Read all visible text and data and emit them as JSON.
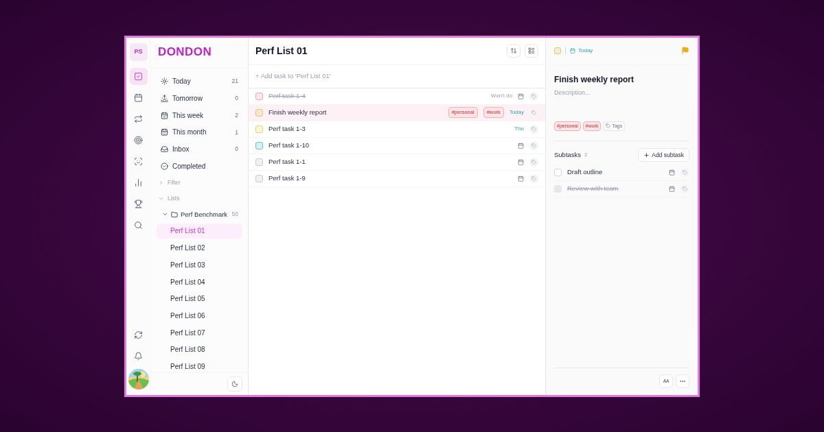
{
  "rail": {
    "avatar": "PS",
    "items": [
      {
        "kind": "tasks",
        "selected": true
      },
      {
        "kind": "calendar",
        "selected": false
      },
      {
        "kind": "repeat",
        "selected": false
      },
      {
        "kind": "target",
        "selected": false
      },
      {
        "kind": "focus",
        "selected": false
      },
      {
        "kind": "stats",
        "selected": false
      },
      {
        "kind": "trophy",
        "selected": false
      },
      {
        "kind": "search",
        "selected": false
      }
    ],
    "bottom": [
      {
        "kind": "sync"
      },
      {
        "kind": "bell"
      }
    ]
  },
  "sidebar": {
    "logo": "DONDON",
    "nav": [
      {
        "kind": "today",
        "label": "Today",
        "count": "21"
      },
      {
        "kind": "tomorrow",
        "label": "Tomorrow",
        "count": "0"
      },
      {
        "kind": "week",
        "label": "This week",
        "count": "2"
      },
      {
        "kind": "month",
        "label": "This month",
        "count": "1"
      },
      {
        "kind": "inbox",
        "label": "Inbox",
        "count": "0"
      },
      {
        "kind": "completed",
        "label": "Completed"
      }
    ],
    "filter": {
      "label": "Filter",
      "expanded": false
    },
    "lists": {
      "label": "Lists",
      "expanded": true,
      "folder": {
        "label": "Perf Benchmark",
        "count": "50",
        "expanded": true,
        "children": [
          {
            "label": "Perf List 01",
            "selected": true
          },
          {
            "label": "Perf List 02",
            "selected": false
          },
          {
            "label": "Perf List 03",
            "selected": false
          },
          {
            "label": "Perf List 04",
            "selected": false
          },
          {
            "label": "Perf List 05",
            "selected": false
          },
          {
            "label": "Perf List 06",
            "selected": false
          },
          {
            "label": "Perf List 07",
            "selected": false
          },
          {
            "label": "Perf List 08",
            "selected": false
          },
          {
            "label": "Perf List 09",
            "selected": false
          }
        ]
      }
    }
  },
  "main": {
    "title": "Perf List 01",
    "add_placeholder": "+ Add task to 'Perf List 01'",
    "tasks": [
      {
        "title": "Perf task 1-4",
        "color": "#f4a3b4",
        "done": true,
        "selected": false,
        "status": "Won't do"
      },
      {
        "title": "Finish weekly report",
        "color": "#e9c46a",
        "done": false,
        "selected": true,
        "due": "Today",
        "tags": [
          "#personal",
          "#work"
        ]
      },
      {
        "title": "Perf task 1-3",
        "color": "#e9d66a",
        "done": false,
        "selected": false,
        "due": "Thu"
      },
      {
        "title": "Perf task 1-10",
        "color": "#5cc8c8",
        "done": false,
        "selected": false
      },
      {
        "title": "Perf task 1-1",
        "color": "#c8c8c8",
        "done": false,
        "selected": false
      },
      {
        "title": "Perf task 1-9",
        "color": "#c8c8c8",
        "done": false,
        "selected": false
      }
    ]
  },
  "detail": {
    "priority": {
      "color": "#e9c46a"
    },
    "date": "Today",
    "flagged": true,
    "title": "Finish weekly report",
    "description_placeholder": "Description...",
    "tags": [
      "#personal",
      "#work"
    ],
    "tags_button": "Tags",
    "subtasks_label": "Subtasks",
    "subtasks_count": "2",
    "add_subtask": "Add subtask",
    "subtasks": [
      {
        "title": "Draft outline",
        "checked": false
      },
      {
        "title": "Review with team",
        "checked": true
      }
    ],
    "font_button": "AA"
  }
}
